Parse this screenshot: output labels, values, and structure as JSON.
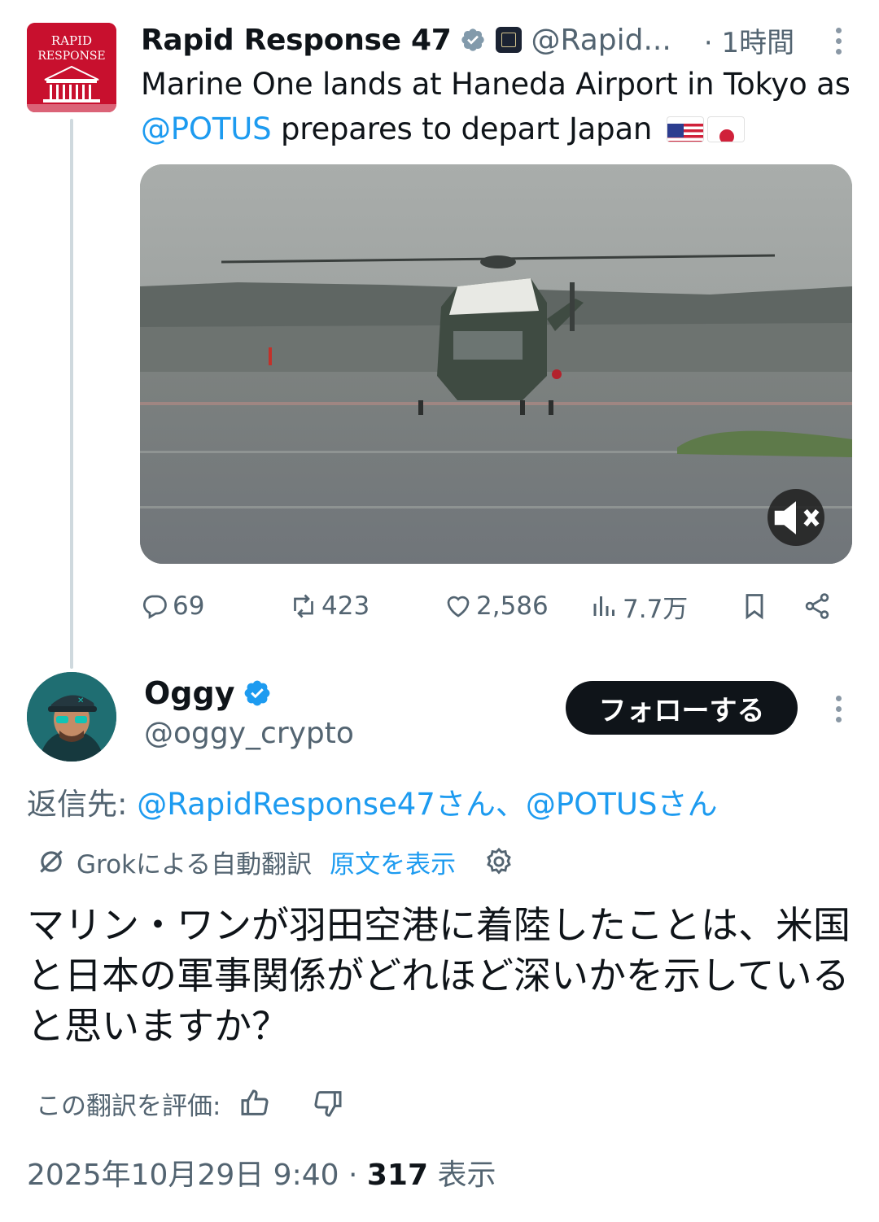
{
  "tweet": {
    "author_name": "Rapid Response 47",
    "author_handle": "@Rapid...",
    "time": "· 1時間",
    "text_before_mention": "Marine One lands at Haneda Airport in Tokyo as ",
    "mention": "@POTUS",
    "text_after_mention": " prepares to depart Japan",
    "avatar_text_line1": "RAPID",
    "avatar_text_line2": "RESPONSE",
    "stats": {
      "replies": "69",
      "reposts": "423",
      "likes": "2,586",
      "views": "7.7万"
    },
    "icons": [
      "reply-icon",
      "repost-icon",
      "like-icon",
      "views-icon",
      "bookmark-icon",
      "share-icon",
      "mute-icon",
      "verified-badge-icon",
      "more-icon"
    ]
  },
  "reply": {
    "author_name": "Oggy",
    "author_handle": "@oggy_crypto",
    "follow_label": "フォローする",
    "reply_to_prefix": "返信先: ",
    "reply_to_mentions": "@RapidResponse47さん、@POTUSさん",
    "grok_label": "Grokによる自動翻訳",
    "show_original_label": "原文を表示",
    "translated_text": "マリン・ワンが羽田空港に着陸したことは、米国と日本の軍事関係がどれほど深いかを示していると思いますか？",
    "rate_label": "この翻訳を評価:",
    "timestamp": "2025年10月29日 9:40 · ",
    "views_count": "317",
    "views_label": " 表示"
  },
  "colors": {
    "accent": "#1d9bf0",
    "text": "#0f1419",
    "secondary": "#536471",
    "brand_red": "#c8102e"
  }
}
